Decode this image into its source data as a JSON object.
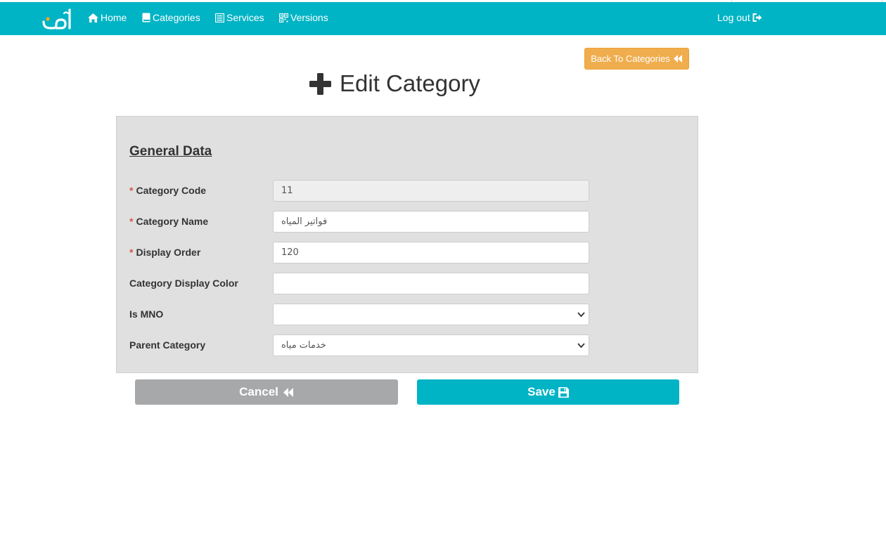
{
  "colors": {
    "navbar": "#00b4c5",
    "back_button": "#f0ad4e",
    "panel": "#e0e0e0",
    "required_star": "#d9534f",
    "cancel_button": "#a7a8aa",
    "save_button": "#00b4c5"
  },
  "brand": {
    "logo_text": "أمان",
    "logo_icon": "aman-logo"
  },
  "navbar": {
    "items": [
      {
        "label": "Home",
        "icon": "home-icon"
      },
      {
        "label": "Categories",
        "icon": "book-icon"
      },
      {
        "label": "Services",
        "icon": "list-icon"
      },
      {
        "label": "Versions",
        "icon": "qrcode-icon"
      }
    ],
    "logout": {
      "label": "Log out",
      "icon": "logout-icon"
    }
  },
  "back_button": {
    "label": "Back To Categories",
    "icon": "backward-icon"
  },
  "page": {
    "title": "Edit Category",
    "title_icon": "plus-icon"
  },
  "form": {
    "section_title": "General Data",
    "required_mark": "*",
    "fields": {
      "category_code": {
        "label": "Category Code",
        "value": "11",
        "required": true
      },
      "category_name": {
        "label": "Category Name",
        "value": "فواتير المياه",
        "required": true
      },
      "display_order": {
        "label": "Display Order",
        "value": "120",
        "required": true
      },
      "display_color": {
        "label": "Category Display Color",
        "value": "",
        "required": false
      },
      "is_mno": {
        "label": "Is MNO",
        "value": "",
        "required": false
      },
      "parent_category": {
        "label": "Parent Category",
        "value": "خدمات مياه",
        "required": false
      }
    }
  },
  "actions": {
    "cancel": {
      "label": "Cancel",
      "icon": "backward-icon"
    },
    "save": {
      "label": "Save",
      "icon": "floppy-disk-icon"
    }
  }
}
